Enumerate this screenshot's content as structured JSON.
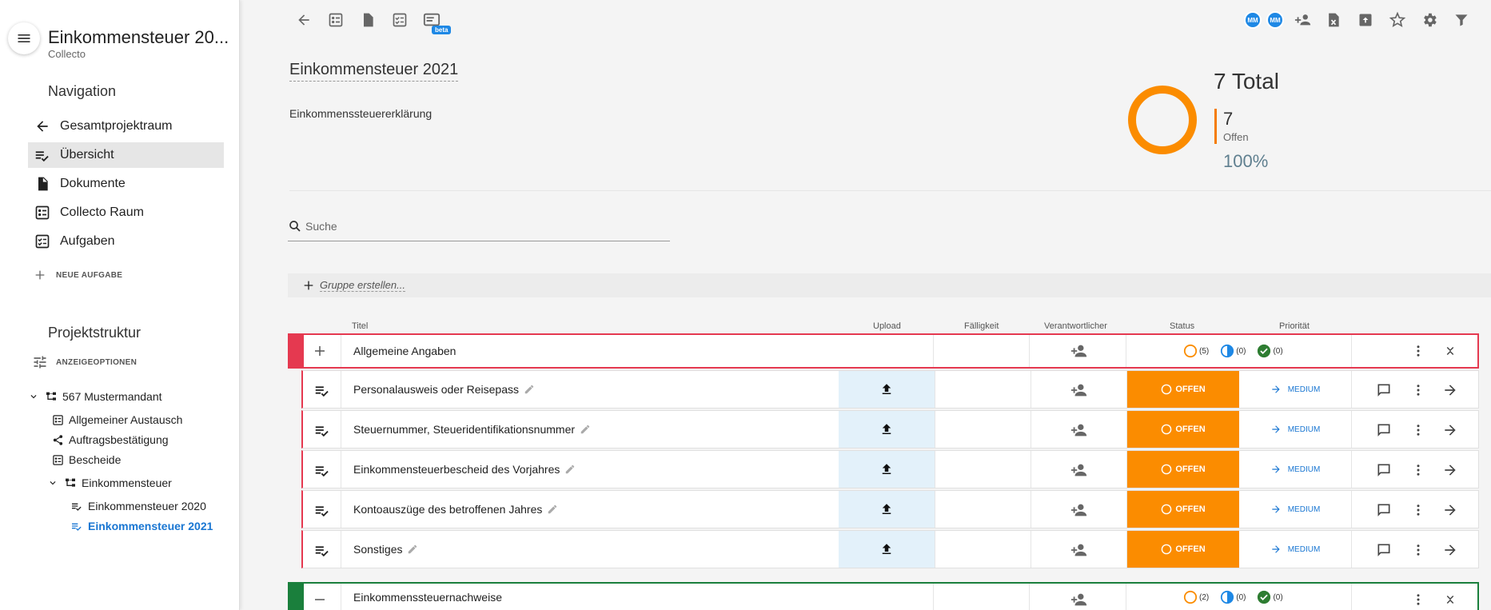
{
  "app": {
    "title": "Einkommensteuer 20...",
    "subtitle": "Collecto"
  },
  "navigation": {
    "title": "Navigation",
    "items": [
      {
        "label": "Gesamtprojektraum",
        "icon": "arrow-left-icon"
      },
      {
        "label": "Übersicht",
        "icon": "checklist-icon"
      },
      {
        "label": "Dokumente",
        "icon": "document-icon"
      },
      {
        "label": "Collecto Raum",
        "icon": "room-icon"
      },
      {
        "label": "Aufgaben",
        "icon": "task-icon"
      }
    ],
    "new_task": "NEUE AUFGABE"
  },
  "project": {
    "title": "Projektstruktur",
    "display_options": "ANZEIGEOPTIONEN",
    "tree": [
      {
        "label": "567 Mustermandant"
      },
      {
        "label": "Allgemeiner Austausch"
      },
      {
        "label": "Auftragsbestätigung"
      },
      {
        "label": "Bescheide"
      },
      {
        "label": "Einkommensteuer"
      },
      {
        "label": "Einkommensteuer 2020"
      },
      {
        "label": "Einkommensteuer 2021"
      }
    ]
  },
  "toolbar": {
    "beta": "beta",
    "avatars": [
      "MM",
      "MM"
    ]
  },
  "header": {
    "title": "Einkommensteuer 2021",
    "description": "Einkommenssteuererklärung"
  },
  "stats": {
    "total": "7 Total",
    "open_count": "7",
    "open_label": "Offen",
    "percent": "100%",
    "ring_color": "#fb8c00"
  },
  "search": {
    "placeholder": "Suche",
    "value": ""
  },
  "group_create": {
    "label": "Gruppe erstellen..."
  },
  "columns": {
    "title": "Titel",
    "upload": "Upload",
    "due": "Fälligkeit",
    "responsible": "Verantwortlicher",
    "status": "Status",
    "priority": "Priorität"
  },
  "groups": [
    {
      "title": "Allgemeine Angaben",
      "open": "(5)",
      "progress": "(0)",
      "done": "(0)",
      "color": "#e53950"
    },
    {
      "title": "Einkommenssteuernachweise",
      "open": "(2)",
      "progress": "(0)",
      "done": "(0)",
      "color": "#1a7f3c"
    }
  ],
  "tasks": [
    {
      "title": "Personalausweis oder Reisepass",
      "status": "OFFEN",
      "priority": "MEDIUM"
    },
    {
      "title": "Steuernummer, Steueridentifikationsnummer",
      "status": "OFFEN",
      "priority": "MEDIUM"
    },
    {
      "title": "Einkommensteuerbescheid des Vorjahres",
      "status": "OFFEN",
      "priority": "MEDIUM"
    },
    {
      "title": "Kontoauszüge des betroffenen Jahres",
      "status": "OFFEN",
      "priority": "MEDIUM"
    },
    {
      "title": "Sonstiges",
      "status": "OFFEN",
      "priority": "MEDIUM"
    }
  ],
  "colors": {
    "accent": "#1976d2",
    "open_status": "#fb8c00",
    "group_red": "#e53950",
    "group_green": "#1a7f3c"
  }
}
